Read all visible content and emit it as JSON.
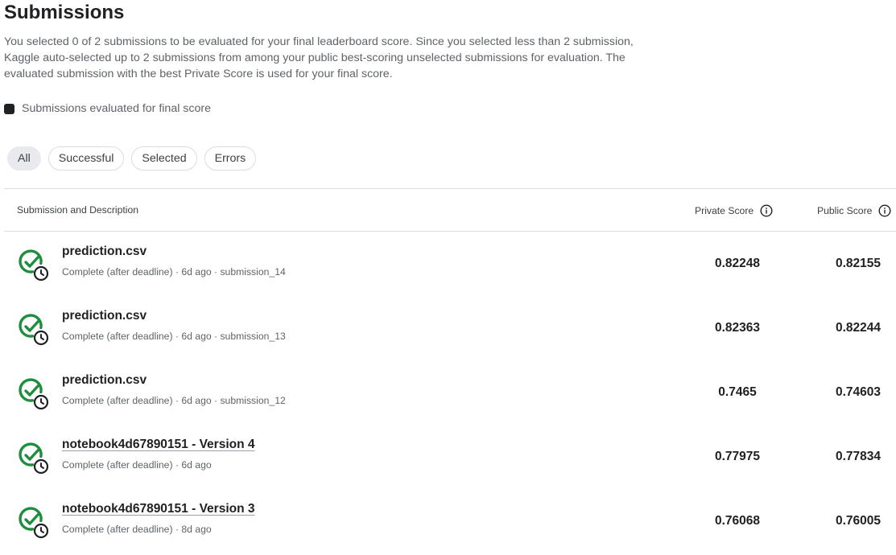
{
  "header": {
    "title": "Submissions",
    "description_lines": [
      "You selected 0 of 2 submissions to be evaluated for your final leaderboard score. Since you selected less than 2 submission,",
      "Kaggle auto-selected up to 2 submissions from among your public best-scoring unselected submissions for evaluation. The",
      "evaluated submission with the best Private Score is used for your final score."
    ]
  },
  "legend": {
    "label": "Submissions evaluated for final score",
    "icon": "dark-square-icon",
    "color": "#202124"
  },
  "filters": [
    {
      "label": "All",
      "active": true
    },
    {
      "label": "Successful",
      "active": false
    },
    {
      "label": "Selected",
      "active": false
    },
    {
      "label": "Errors",
      "active": false
    }
  ],
  "table": {
    "headers": {
      "submission": "Submission and Description",
      "private_score": "Private Score",
      "public_score": "Public Score",
      "info_icon": "info-circle-icon"
    },
    "rows": [
      {
        "name": "prediction.csv",
        "meta": "Complete (after deadline) · 6d ago · submission_14",
        "private": "0.82248",
        "public": "0.82155",
        "is_link": false
      },
      {
        "name": "prediction.csv",
        "meta": "Complete (after deadline) · 6d ago · submission_13",
        "private": "0.82363",
        "public": "0.82244",
        "is_link": false
      },
      {
        "name": "prediction.csv",
        "meta": "Complete (after deadline) · 6d ago · submission_12",
        "private": "0.7465",
        "public": "0.74603",
        "is_link": false
      },
      {
        "name": "notebook4d67890151 - Version 4",
        "meta": "Complete (after deadline) · 6d ago",
        "private": "0.77975",
        "public": "0.77834",
        "is_link": true
      },
      {
        "name": "notebook4d67890151 - Version 3",
        "meta": "Complete (after deadline) · 8d ago",
        "private": "0.76068",
        "public": "0.76005",
        "is_link": true
      }
    ],
    "status_icon": "check-clock-icon",
    "status_color": "#1e8e3e"
  }
}
